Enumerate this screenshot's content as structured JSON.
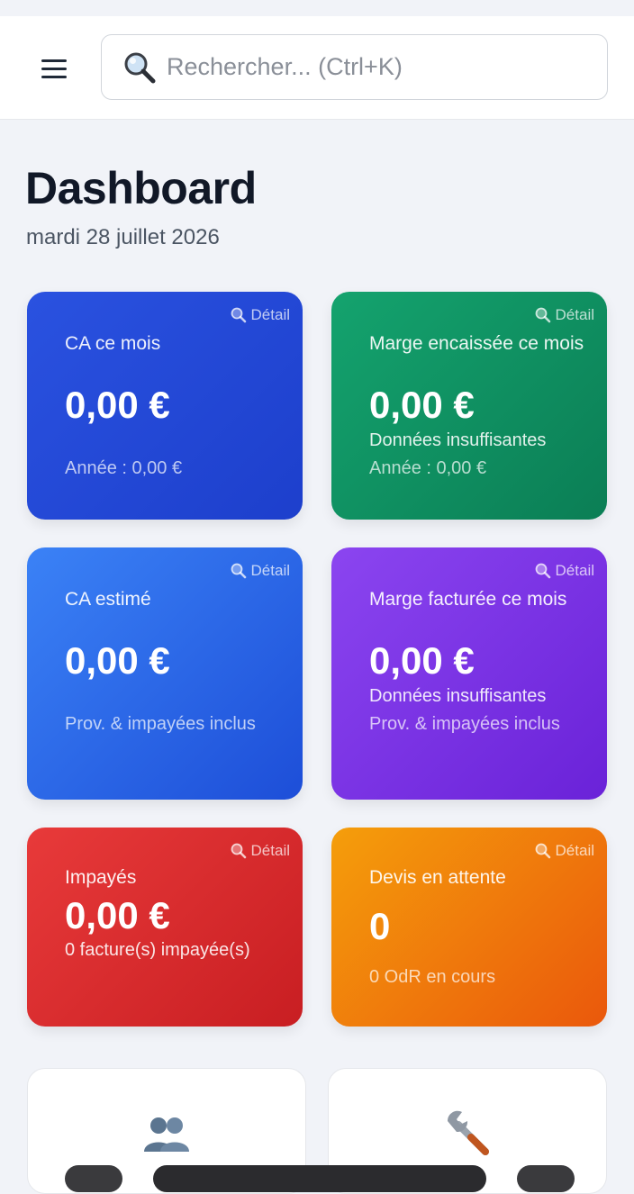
{
  "header": {
    "search_placeholder": "Rechercher... (Ctrl+K)"
  },
  "page": {
    "title": "Dashboard",
    "date": "mardi 28 juillet 2026"
  },
  "cards": [
    {
      "detail": "Détail",
      "label": "CA ce mois",
      "value": "0,00 €",
      "sub": "Année : 0,00 €",
      "color": "#2448d8"
    },
    {
      "detail": "Détail",
      "label": "Marge encaissée ce mois",
      "value": "0,00 €",
      "sub": "Données insuffisantes",
      "sub2": "Année : 0,00 €",
      "color": "#10915f"
    },
    {
      "detail": "Détail",
      "label": "CA estimé",
      "value": "0,00 €",
      "sub": "Prov. & impayées inclus",
      "color": "#2f6de8"
    },
    {
      "detail": "Détail",
      "label": "Marge facturée ce mois",
      "value": "0,00 €",
      "sub": "Données insuffisantes",
      "sub2": "Prov. & impayées inclus",
      "color": "#7c34e6"
    },
    {
      "detail": "Détail",
      "label": "Impayés",
      "value": "0,00 €",
      "sub": "0 facture(s) impayée(s)",
      "color": "#d8292d"
    },
    {
      "detail": "Détail",
      "label": "Devis en attente",
      "value": "0",
      "sub": "0 OdR en cours",
      "color": "#f07f0a"
    }
  ],
  "tiles": [
    {
      "icon": "users-icon"
    },
    {
      "icon": "wrench-icon"
    }
  ]
}
